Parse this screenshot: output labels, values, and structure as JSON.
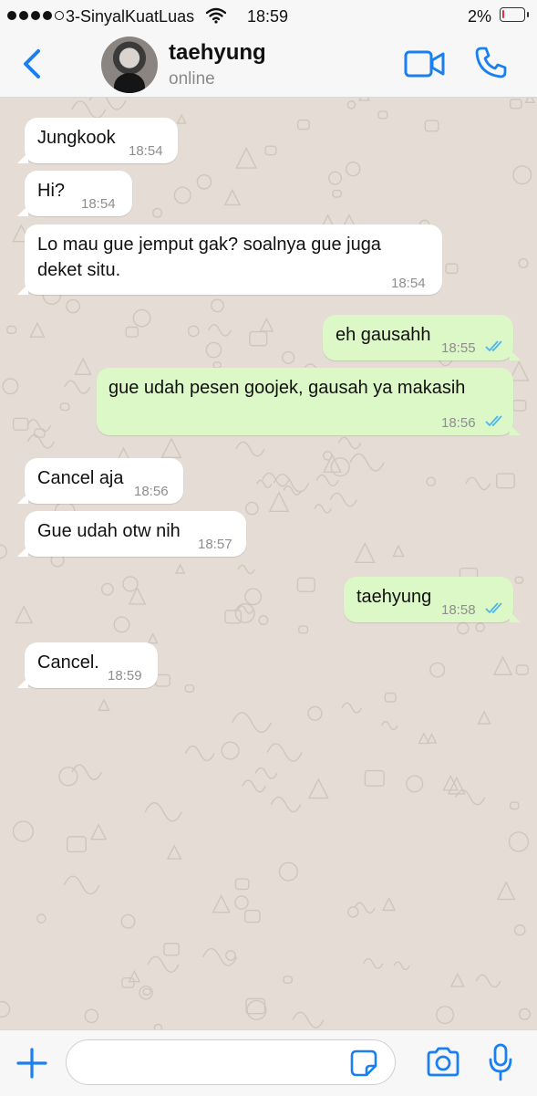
{
  "status_bar": {
    "carrier": "3-SinyalKuatLuas",
    "time": "18:59",
    "battery_percent": "2%",
    "battery_level": 0.02,
    "signal_dots": [
      true,
      true,
      true,
      true,
      false
    ]
  },
  "header": {
    "contact_name": "taehyung",
    "contact_status": "online",
    "icons": {
      "back": "chevron-left-icon",
      "video": "video-camera-icon",
      "call": "phone-icon"
    }
  },
  "messages": [
    {
      "dir": "in",
      "text": "Jungkook",
      "time": "18:54"
    },
    {
      "dir": "in",
      "text": "Hi?",
      "time": "18:54"
    },
    {
      "dir": "in",
      "line1": "Lo mau gue jemput gak? soalnya gue juga",
      "line2": "deket situ.",
      "time": "18:54"
    },
    {
      "dir": "out",
      "text": "eh gausahh",
      "time": "18:55",
      "read": true
    },
    {
      "dir": "out",
      "text": "gue udah pesen goojek, gausah ya makasih",
      "time": "18:56",
      "read": true
    },
    {
      "dir": "in",
      "text": "Cancel aja",
      "time": "18:56"
    },
    {
      "dir": "in",
      "text": "Gue udah otw nih",
      "time": "18:57"
    },
    {
      "dir": "out",
      "text": "taehyung",
      "time": "18:58",
      "read": true
    },
    {
      "dir": "in",
      "text": "Cancel.",
      "time": "18:59"
    }
  ],
  "input_bar": {
    "value": "",
    "placeholder": "",
    "icons": {
      "add": "plus-icon",
      "sticker": "sticker-icon",
      "camera": "camera-icon",
      "mic": "microphone-icon"
    }
  },
  "colors": {
    "accent": "#1a7ff0",
    "incoming_bubble": "#ffffff",
    "outgoing_bubble": "#dcf8c6",
    "chat_background": "#e5ddd5",
    "read_ticks": "#4fb6ec"
  }
}
